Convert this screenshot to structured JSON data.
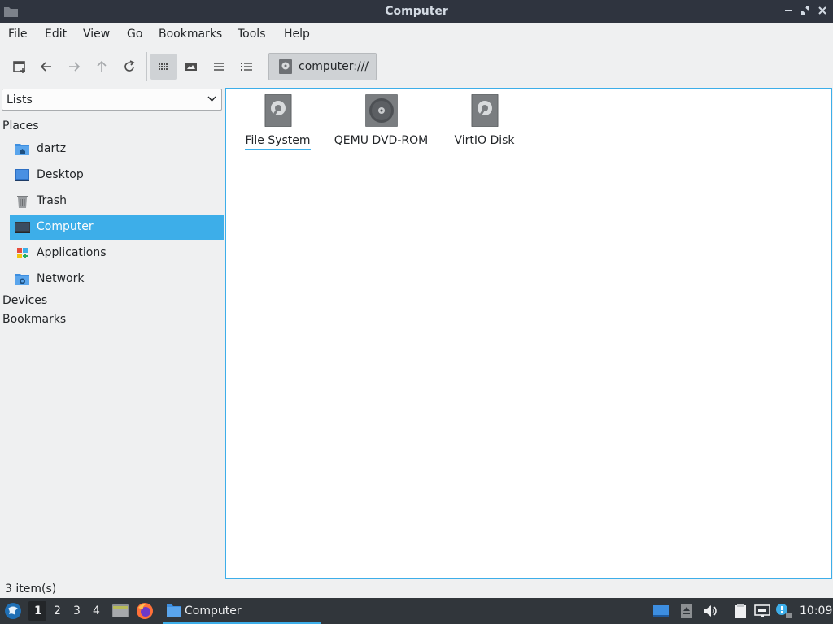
{
  "window": {
    "title": "Computer"
  },
  "menubar": {
    "items": [
      "File",
      "Edit",
      "View",
      "Go",
      "Bookmarks",
      "Tools",
      "Help"
    ]
  },
  "toolbar": {
    "path": "computer:///",
    "active_view": "icon-view"
  },
  "sidebar": {
    "selector": "Lists",
    "places_header": "Places",
    "places": [
      {
        "label": "dartz",
        "icon": "home-folder-icon"
      },
      {
        "label": "Desktop",
        "icon": "desktop-icon"
      },
      {
        "label": "Trash",
        "icon": "trash-icon"
      },
      {
        "label": "Computer",
        "icon": "computer-icon",
        "selected": true
      },
      {
        "label": "Applications",
        "icon": "applications-icon"
      },
      {
        "label": "Network",
        "icon": "network-icon"
      }
    ],
    "devices_header": "Devices",
    "bookmarks_header": "Bookmarks"
  },
  "content": {
    "items": [
      {
        "label": "File System",
        "icon": "harddisk-icon",
        "focused": true
      },
      {
        "label": "QEMU DVD-ROM",
        "icon": "optical-drive-icon"
      },
      {
        "label": "VirtIO Disk",
        "icon": "harddisk-icon"
      }
    ]
  },
  "status": {
    "text": "3 item(s)"
  },
  "taskbar": {
    "workspaces": [
      "1",
      "2",
      "3",
      "4"
    ],
    "current_workspace": "1",
    "task": "Computer",
    "clock": "10:09"
  },
  "colors": {
    "accent": "#3daee9",
    "titlebar": "#2f343f",
    "taskbar": "#31363b"
  }
}
